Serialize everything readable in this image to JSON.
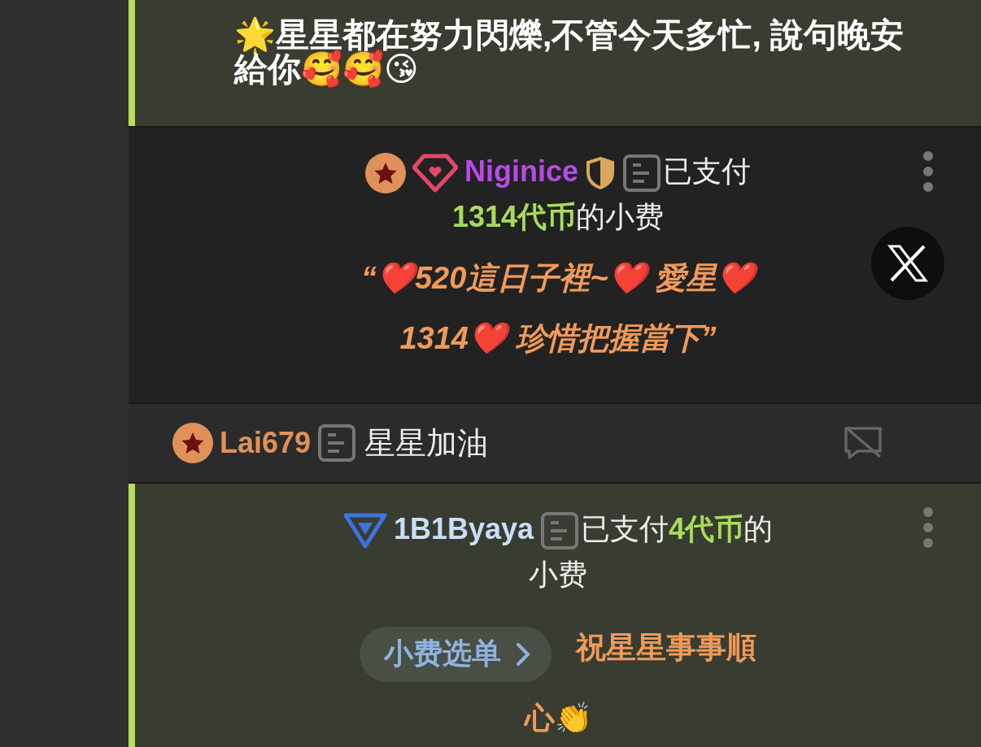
{
  "messages": [
    {
      "kind": "text",
      "highlighted": true,
      "text": "🌟星星都在努力閃爍,不管今天多忙, 說句晚安給你🥰🥰😘"
    },
    {
      "kind": "tip",
      "highlighted": false,
      "user": {
        "name": "Niginice",
        "color": "#b84ae6",
        "badges": [
          {
            "kind": "star"
          },
          {
            "kind": "diamond"
          }
        ],
        "marks": [
          {
            "kind": "shield"
          }
        ]
      },
      "tip_lines": [
        [
          {
            "kind": "plain",
            "text": "已支付"
          }
        ],
        [
          {
            "kind": "amount",
            "text": "1314代币"
          },
          {
            "kind": "plain",
            "text": "的小费"
          }
        ]
      ],
      "quote": "“❤️520這日子裡~❤️ 愛星❤️ 1314❤️ 珍惜把握當下”",
      "actions": [
        {
          "kind": "more"
        },
        {
          "kind": "close"
        }
      ]
    },
    {
      "kind": "chat",
      "highlighted": false,
      "user": {
        "name": "Lai679",
        "color": "#e0915a",
        "badges": [
          {
            "kind": "star"
          }
        ]
      },
      "text": "星星加油"
    },
    {
      "kind": "tip",
      "highlighted": true,
      "user": {
        "name": "1B1Byaya",
        "color": "#c9def7",
        "badges": [
          {
            "kind": "triangle"
          }
        ]
      },
      "tip_lines": [
        [
          {
            "kind": "plain",
            "text": "已支付"
          },
          {
            "kind": "amount",
            "text": "4代币"
          },
          {
            "kind": "plain",
            "text": "的"
          }
        ],
        [
          {
            "kind": "plain",
            "text": "小费"
          }
        ]
      ],
      "menu_button": "小费选单",
      "note": "祝星星事事順心👏",
      "actions": [
        {
          "kind": "more"
        }
      ]
    }
  ]
}
